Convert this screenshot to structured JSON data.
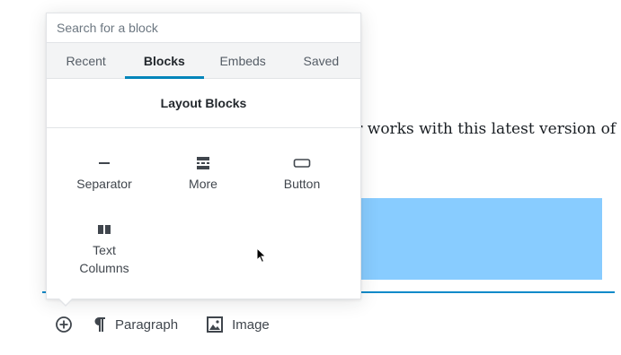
{
  "editor": {
    "paragraph_text": "or works with this latest version of",
    "highlight_color": "#88ccff",
    "accent_color": "#0085ba"
  },
  "inserter": {
    "search_placeholder": "Search for a block",
    "tabs": [
      {
        "label": "Recent",
        "active": false
      },
      {
        "label": "Blocks",
        "active": true
      },
      {
        "label": "Embeds",
        "active": false
      },
      {
        "label": "Saved",
        "active": false
      }
    ],
    "section_title": "Layout Blocks",
    "blocks": [
      {
        "label": "Separator",
        "icon": "separator-icon"
      },
      {
        "label": "More",
        "icon": "more-icon"
      },
      {
        "label": "Button",
        "icon": "button-icon"
      },
      {
        "label": "Text Columns",
        "icon": "columns-icon"
      }
    ]
  },
  "toolbar": {
    "add_icon": "plus-circle-icon",
    "shortcuts": [
      {
        "label": "Paragraph",
        "icon": "paragraph-icon"
      },
      {
        "label": "Image",
        "icon": "image-icon"
      }
    ]
  }
}
